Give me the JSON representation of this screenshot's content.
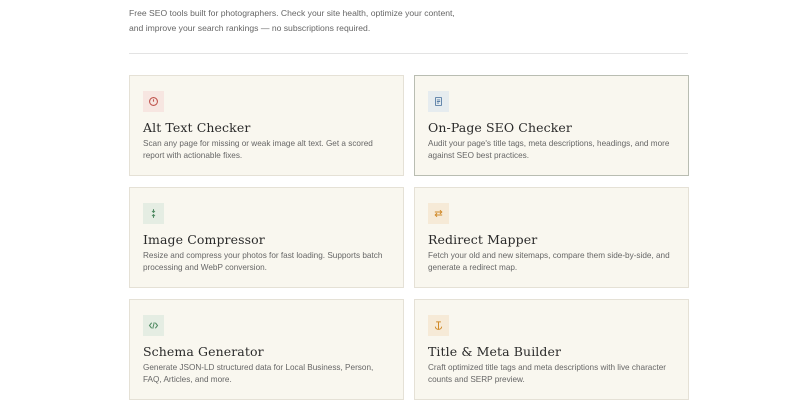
{
  "intro": {
    "line1": "Free SEO tools built for photographers. Check your site health, optimize your content,",
    "line2": "and improve your search rankings — no subscriptions required."
  },
  "tools": [
    {
      "title": "Alt Text Checker",
      "description": "Scan any page for missing or weak image alt text. Get a scored report with actionable fixes.",
      "icon": "clock-icon",
      "icon_color": "#c0564f",
      "icon_bg": "#f7e6e1"
    },
    {
      "title": "On-Page SEO Checker",
      "description": "Audit your page's title tags, meta descriptions, headings, and more against SEO best practices.",
      "icon": "document-icon",
      "icon_color": "#5a7fa6",
      "icon_bg": "#e6ecef"
    },
    {
      "title": "Image Compressor",
      "description": "Resize and compress your photos for fast loading. Supports batch processing and WebP conversion.",
      "icon": "compress-arrows-icon",
      "icon_color": "#4f8a62",
      "icon_bg": "#e5ede3"
    },
    {
      "title": "Redirect Mapper",
      "description": "Fetch your old and new sitemaps, compare them side-by-side, and generate a redirect map.",
      "icon": "swap-arrows-icon",
      "icon_color": "#d08a2a",
      "icon_bg": "#f6ead7"
    },
    {
      "title": "Schema Generator",
      "description": "Generate JSON-LD structured data for Local Business, Person, FAQ, Articles, and more.",
      "icon": "code-brackets-icon",
      "icon_color": "#4f8a62",
      "icon_bg": "#e5ede3"
    },
    {
      "title": "Title & Meta Builder",
      "description": "Craft optimized title tags and meta descriptions with live character counts and SERP preview.",
      "icon": "anchor-icon",
      "icon_color": "#d08a2a",
      "icon_bg": "#f6ead7"
    }
  ]
}
